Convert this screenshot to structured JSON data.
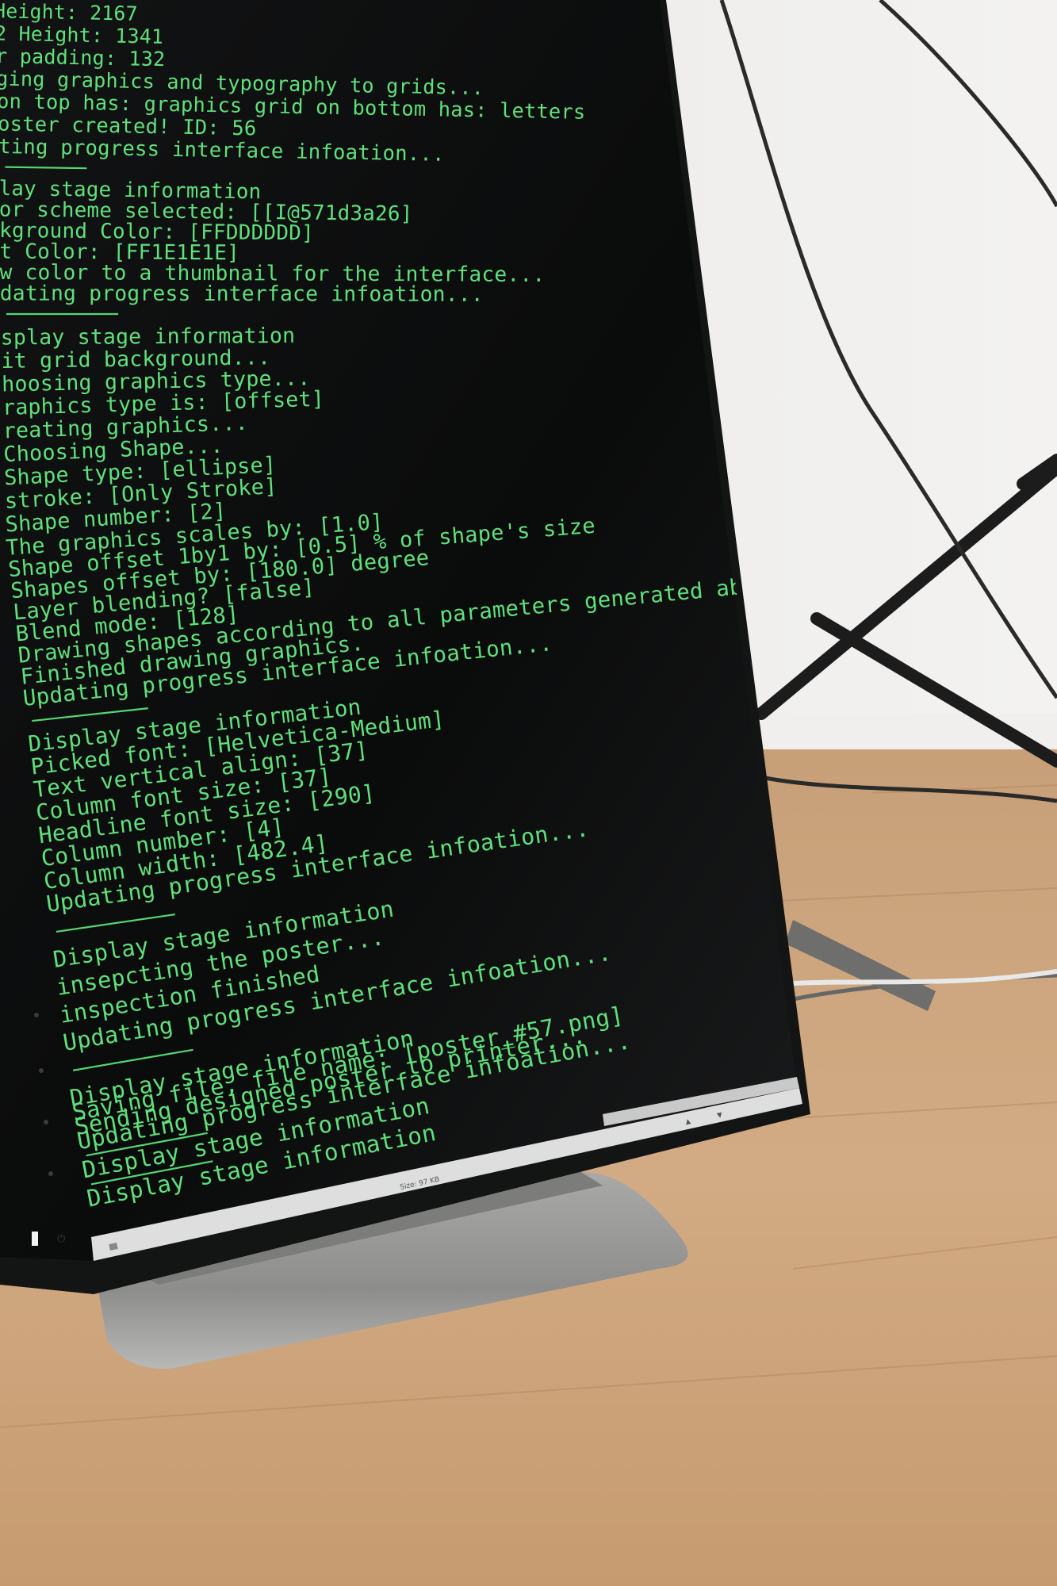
{
  "scene": {
    "description_free": true,
    "colors": {
      "terminal_text": "#5fe07a",
      "terminal_bg": "#0c0d0d",
      "bezel": "#151616",
      "wall": "#ecebe8",
      "floor": "#c9a27a",
      "stand": "#9a9a9a"
    }
  },
  "terminal": {
    "lines": [
      " Height: 2167",
      "2 Height: 1341",
      "r padding: 132",
      "ging graphics and typography to grids...",
      "on top has: graphics grid on bottom has: letters",
      "oster created! ID: 56",
      "ting progress interface infoation...",
      "---------",
      "lay stage information",
      "or scheme selected: [[I@571d3a26]",
      "kground Color: [FFDDDDDD]",
      "t Color: [FF1E1E1E]",
      "w color to a thumbnail for the interface...",
      "dating progress interface infoation...",
      "------------",
      "splay stage information",
      "it grid background...",
      "hoosing graphics type...",
      "raphics type is: [offset]",
      "reating graphics...",
      "Choosing Shape...",
      "Shape type: [ellipse]",
      "stroke: [Only Stroke]",
      "Shape number: [2]",
      "The graphics scales by: [1.0]",
      "Shape offset 1by1 by: [0.5] % of shape's size",
      "Shapes offset by: [180.0] degree",
      "Layer blending? [false]",
      "Blend mode: [128]",
      "Drawing shapes according to all parameters generated above...",
      "Finished drawing graphics.",
      "Updating progress interface infoation...",
      "------------",
      "Display stage information",
      "Picked font: [Helvetica-Medium]",
      "Text vertical align: [37]",
      "Column font size: [37]",
      "Headline font size: [290]",
      "Column number: [4]",
      "Column width: [482.4]",
      "Updating progress interface infoation...",
      "------------",
      "Display stage information",
      "insepcting the poster...",
      "inspection finished",
      "Updating progress interface infoation...",
      "------------",
      "Display stage information",
      "Saving file, file name: [poster_#57.png]",
      "Sending designed poster to printer...",
      "Updating progress interface infoation...",
      "------------",
      "Display stage information",
      "------------",
      "Display stage information"
    ],
    "status_bar": {
      "size_label": "Size: 97 KB"
    }
  }
}
